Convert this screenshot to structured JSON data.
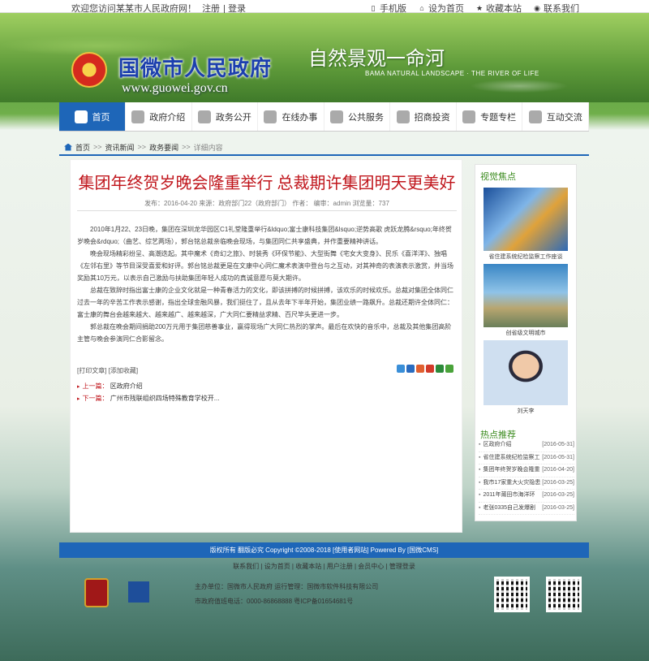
{
  "topbar": {
    "welcome": "欢迎您访问某某市人民政府网！",
    "register": "注册",
    "login": "登录",
    "links": [
      {
        "icon": "mobile-icon",
        "label": "手机版"
      },
      {
        "icon": "home-icon",
        "label": "设为首页"
      },
      {
        "icon": "star-icon",
        "label": "收藏本站"
      },
      {
        "icon": "location-icon",
        "label": "联系我们"
      }
    ]
  },
  "banner": {
    "title": "国微市人民政府",
    "url": "www.guowei.gov.cn",
    "slogan": "自然景观一命河",
    "slogan_en": "BAMA NATURAL LANDSCAPE · THE RIVER OF LIFE"
  },
  "nav": [
    {
      "label": "首页",
      "active": true
    },
    {
      "label": "政府介绍"
    },
    {
      "label": "政务公开"
    },
    {
      "label": "在线办事"
    },
    {
      "label": "公共服务"
    },
    {
      "label": "招商投资"
    },
    {
      "label": "专题专栏"
    },
    {
      "label": "互动交流"
    }
  ],
  "breadcrumb": [
    "首页",
    "资讯新闻",
    "政务要闻",
    "详细内容"
  ],
  "article": {
    "title": "集团年终贺岁晚会隆重举行 总裁期许集团明天更美好",
    "meta": "发布：2016-04-20 来源：政府部门22（政府部门） 作者： 编审：admin 浏览量：737",
    "paragraphs": [
      "2010年1月22、23日晚，集团在深圳龙华园区C1礼堂隆重举行&ldquo;富士康科技集团&lsquo;逆势高歌 虎跃龙腾&rsquo;年终贺岁晚会&rdquo;（曲艺、综艺两场），郭台铭总裁亲临晚会现场，与集团同仁共享盛典，并作重要精神讲话。",
      "晚会现场精彩纷呈、高潮迭起。其中魔术《奇幻之旅》、时装秀《环保节能》、大型街舞《宅女大变身》、民乐《喜洋洋》、独唱《左邻右里》等节目深受喜爱和好评。郭台铭总裁更是在文康中心同仁魔术表演中登台与之互动，对其神奇的表演表示激赏，并当场奖励其10万元，以表示自己激励与扶助集团年轻人成功的真诚意愿与莫大期许。",
      "总裁在致辞时指出富士康的企业文化就是一种青春活力的文化，即该拼搏的时候拼搏，该欢乐的时候欢乐。总裁对集团全体同仁过去一年的辛苦工作表示感谢，指出全球金融风暴，我们挺住了，且从去年下半年开始，集团业绩一路飙升。总裁还期许全体同仁：富士康的舞台会越来越大、越来越广、越来越深，广大同仁要精益求精、百尺竿头更进一步。",
      "郭总裁在晚会期间捐助200万元用于集团慈善事业，赢得现场广大同仁热烈的掌声。最后在欢快的音乐中，总裁及其他集团高阶主管与晚会参演同仁合影留念。"
    ],
    "print_label": "[打印文章]",
    "fav_label": "[添加收藏]",
    "prev_label": "上一篇：",
    "prev_title": "区政府介绍",
    "next_label": "下一篇：",
    "next_title": "广州市残联组织四场特殊教育学校开..."
  },
  "sidebar": {
    "focus_title": "视觉焦点",
    "focus_items": [
      {
        "caption": "省住建系统纪检监察工作座谈"
      },
      {
        "caption": "创省级文明城市"
      },
      {
        "caption": "刘天李"
      }
    ],
    "hot_title": "热点推荐",
    "hot_items": [
      {
        "title": "区政府介绍",
        "date": "[2016-05-31]"
      },
      {
        "title": "省住建系统纪检监察工",
        "date": "[2016-05-31]"
      },
      {
        "title": "集团年终贺岁晚会隆重",
        "date": "[2016-04-20]"
      },
      {
        "title": "我市17家重大火灾隐患",
        "date": "[2016-03-25]"
      },
      {
        "title": "2011年莆田市海洋环",
        "date": "[2016-03-25]"
      },
      {
        "title": "老张0335自己发爆剧",
        "date": "[2016-03-25]"
      }
    ]
  },
  "footer": {
    "copyright": "版权所有 翻版必究 Copyright ©2008-2018 [使用者网站] Powered By [国微CMS]",
    "links": [
      "联系我们",
      "设为首页",
      "收藏本站",
      "用户注册",
      "会员中心",
      "管理登录"
    ],
    "host": "主办单位：国微市人民政府 运行管理：国微市软件科技有限公司",
    "contact": "市政府值班电话：0000-86868888 粤ICP备01654681号"
  }
}
